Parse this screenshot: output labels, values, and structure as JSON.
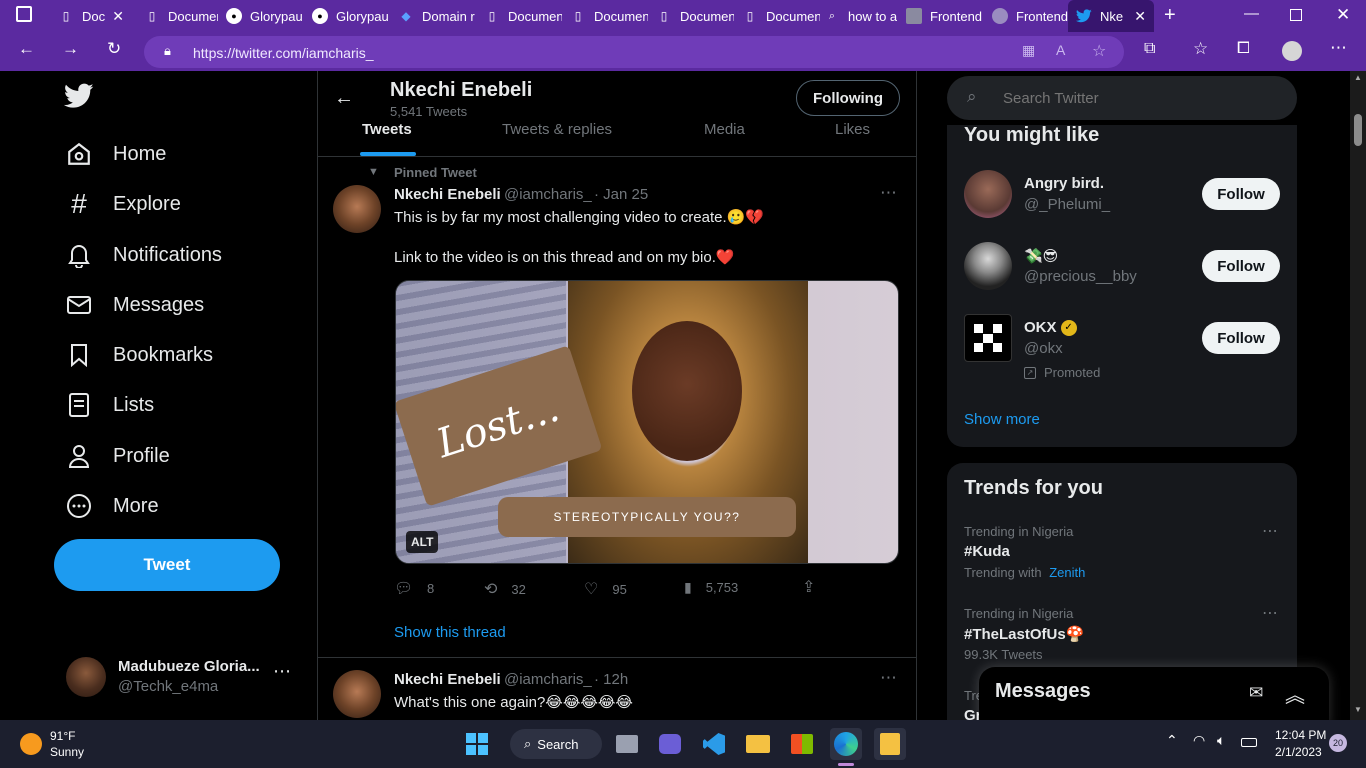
{
  "browser": {
    "tabs": [
      {
        "title": "Doc",
        "icon": "doc-icon"
      },
      {
        "title": "Documen",
        "icon": "doc-icon"
      },
      {
        "title": "Glorypau",
        "icon": "github-icon"
      },
      {
        "title": "Glorypau",
        "icon": "github-icon"
      },
      {
        "title": "Domain r",
        "icon": "diamond-icon"
      },
      {
        "title": "Documen",
        "icon": "doc-icon"
      },
      {
        "title": "Documen",
        "icon": "doc-icon"
      },
      {
        "title": "Documen",
        "icon": "doc-icon"
      },
      {
        "title": "Documen",
        "icon": "doc-icon"
      },
      {
        "title": "how to a",
        "icon": "search-icon"
      },
      {
        "title": "Frontend",
        "icon": "image-icon"
      },
      {
        "title": "Frontend",
        "icon": "globe-icon"
      },
      {
        "title": "Nke",
        "icon": "twitter-icon"
      }
    ],
    "url": "https://twitter.com/iamcharis_"
  },
  "nav": {
    "items": [
      {
        "label": "Home",
        "icon": "home-icon"
      },
      {
        "label": "Explore",
        "icon": "hashtag-icon"
      },
      {
        "label": "Notifications",
        "icon": "bell-icon"
      },
      {
        "label": "Messages",
        "icon": "envelope-icon"
      },
      {
        "label": "Bookmarks",
        "icon": "bookmark-icon"
      },
      {
        "label": "Lists",
        "icon": "list-icon"
      },
      {
        "label": "Profile",
        "icon": "person-icon"
      },
      {
        "label": "More",
        "icon": "more-circle-icon"
      }
    ],
    "tweet_button": "Tweet",
    "account": {
      "name": "Madubueze Gloria...",
      "handle": "@Techk_e4ma"
    }
  },
  "profile_header": {
    "name": "Nkechi Enebeli",
    "tweet_count": "5,541 Tweets",
    "following_button": "Following",
    "tabs": [
      "Tweets",
      "Tweets & replies",
      "Media",
      "Likes"
    ]
  },
  "tweets": [
    {
      "pinned_label": "Pinned Tweet",
      "name": "Nkechi Enebeli",
      "handle": "@iamcharis_",
      "time": "· Jan 25",
      "text1": "This is by far my most challenging video to create.🥲💔",
      "text2": "Link to the video is on this thread and on my bio.❤️",
      "image_text_lost": "Lost...",
      "image_text_caption": "STEREOTYPICALLY YOU??",
      "alt_badge": "ALT",
      "replies": "8",
      "retweets": "32",
      "likes": "95",
      "views": "5,753",
      "show_thread": "Show this thread"
    },
    {
      "name": "Nkechi Enebeli",
      "handle": "@iamcharis_",
      "time": "· 12h",
      "text1": "What's this one again?😂😂😂😂😂"
    }
  ],
  "search": {
    "placeholder": "Search Twitter"
  },
  "you_might_like": {
    "title": "You might like",
    "users": [
      {
        "name": "Angry bird.",
        "handle": "@_Phelumi_",
        "follow": "Follow"
      },
      {
        "name": "💸😎",
        "handle": "@precious__bby",
        "follow": "Follow"
      },
      {
        "name": "OKX",
        "handle": "@okx",
        "follow": "Follow",
        "promoted": "Promoted"
      }
    ],
    "show_more": "Show more"
  },
  "trends": {
    "title": "Trends for you",
    "items": [
      {
        "context": "Trending in Nigeria",
        "name": "#Kuda",
        "extra_prefix": "Trending with",
        "extra_link": "Zenith"
      },
      {
        "context": "Trending in Nigeria",
        "name": "#TheLastOfUs🍄",
        "extra_prefix": "99.3K Tweets",
        "extra_link": ""
      }
    ],
    "partial_context": "Tre",
    "partial_name": "Gr"
  },
  "messages_drawer": {
    "title": "Messages"
  },
  "taskbar": {
    "weather_temp": "91°F",
    "weather_desc": "Sunny",
    "search_label": "Search",
    "time": "12:04 PM",
    "date": "2/1/2023",
    "notif_count": "20"
  },
  "colors": {
    "accent": "#1d9bf0",
    "browser": "#5b2aa0",
    "taskbar": "#1c1f2e"
  }
}
